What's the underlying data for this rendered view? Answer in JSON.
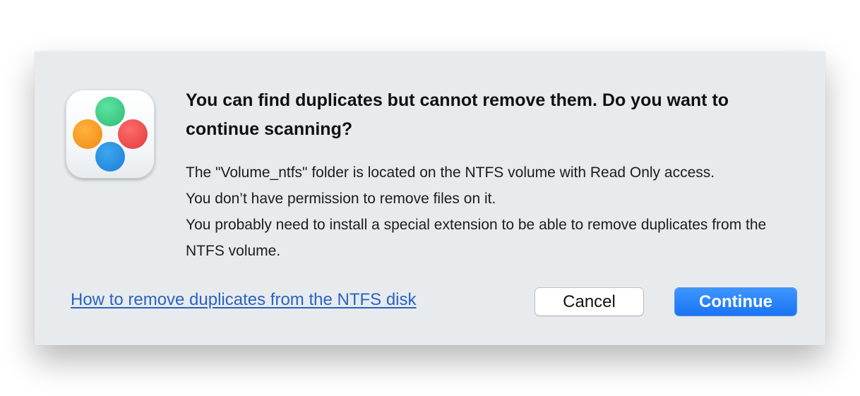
{
  "dialog": {
    "title": "You can find duplicates but cannot remove them. Do you want to continue scanning?",
    "message": {
      "line1": "The \"Volume_ntfs\" folder is located on the NTFS volume with Read Only access.",
      "line2": "You don’t have permission to remove files on it.",
      "line3": "You probably need to install a special extension to be able to remove duplicates from the NTFS volume."
    },
    "help_link": "How to remove duplicates from the NTFS disk",
    "cancel_label": "Cancel",
    "continue_label": "Continue",
    "icon": "app-icon-four-colored-dots"
  },
  "colors": {
    "link": "#2a63bf",
    "primary_button": "#1a74f4",
    "dialog_background": "#e8ebee",
    "dot_green": "#2bbd74",
    "dot_orange": "#f08a12",
    "dot_red": "#e03b3b",
    "dot_blue": "#1a7ed6"
  }
}
